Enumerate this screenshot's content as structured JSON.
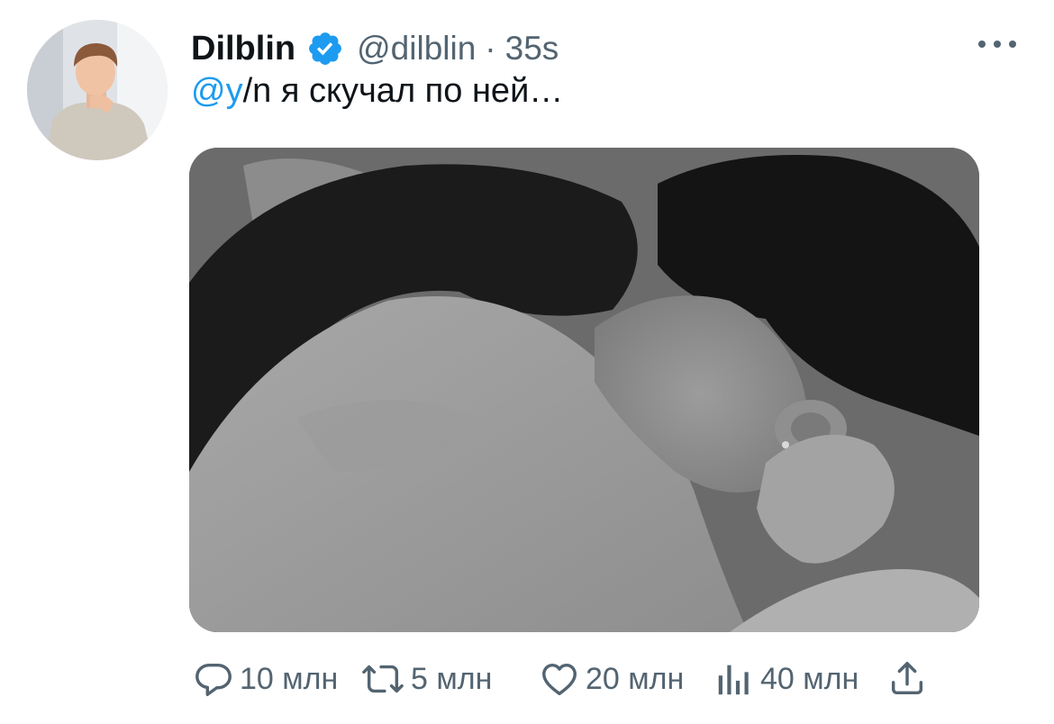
{
  "author": {
    "display_name": "Dilblin",
    "handle": "@dilblin",
    "separator": "·",
    "timestamp": "35s",
    "verified": true,
    "verified_color": "#1d9bf0"
  },
  "tweet": {
    "mention": "@y",
    "text_rest": "/n я скучал по ней…",
    "mention_color": "#1d9bf0"
  },
  "actions": {
    "reply_count": "10 млн",
    "retweet_count": "5 млн",
    "like_count": "20 млн",
    "views_count": "40 млн"
  },
  "icons": [
    "more-icon",
    "verified-badge-icon",
    "reply-icon",
    "retweet-icon",
    "like-icon",
    "views-icon",
    "share-icon"
  ]
}
